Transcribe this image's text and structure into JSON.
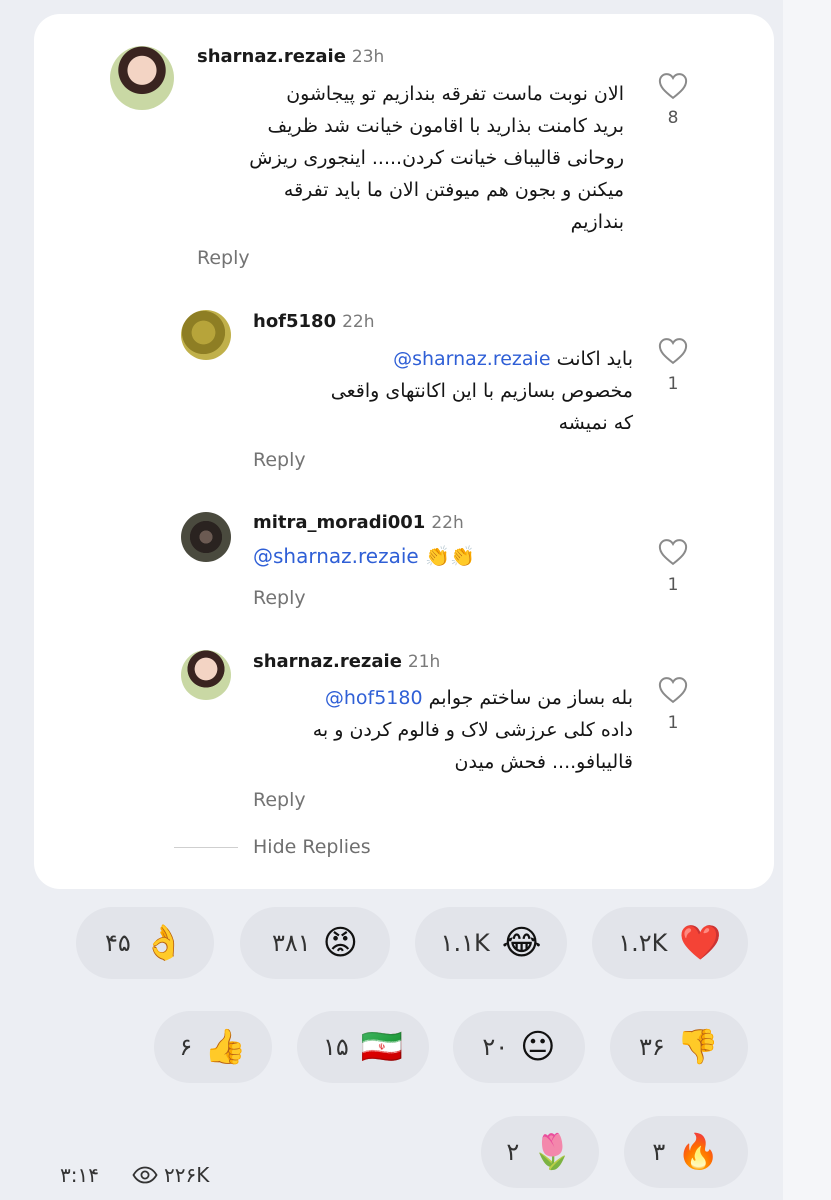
{
  "comments": [
    {
      "username": "sharnaz.rezaie",
      "time": "23h",
      "text_lines": [
        "الان نوبت ماست تفرقه بندازیم تو پیجاشون",
        "برید کامنت بذارید با اقامون خیانت شد ظریف",
        "روحانی قالیباف خیانت کردن..... اینجوری ریزش",
        "میکنن و بجون هم میوفتن الان ما باید تفرقه",
        "بندازیم"
      ],
      "likes": "8",
      "reply_label": "Reply"
    },
    {
      "username": "hof5180",
      "time": "22h",
      "mention": "@sharnaz.rezaie",
      "text_first": "باید اکانت",
      "text_lines": [
        "مخصوص بسازیم با این اکانتهای واقعی",
        "که نمیشه"
      ],
      "likes": "1",
      "reply_label": "Reply"
    },
    {
      "username": "mitra_moradi001",
      "time": "22h",
      "mention": "@sharnaz.rezaie",
      "emoji": "👏👏",
      "likes": "1",
      "reply_label": "Reply"
    },
    {
      "username": "sharnaz.rezaie",
      "time": "21h",
      "mention": "@hof5180",
      "text_first": "بله بساز من ساختم جوابم",
      "text_lines": [
        "داده کلی عرزشی لاک و فالوم کردن و به",
        "قالیبافو.... فحش میدن"
      ],
      "likes": "1",
      "reply_label": "Reply"
    }
  ],
  "hide_replies": "Hide Replies",
  "reactions": [
    {
      "emoji": "❤️",
      "count": "۱.۲K",
      "icon": "heart-emoji"
    },
    {
      "emoji": "😂",
      "count": "۱.۱K",
      "icon": "laughing-emoji"
    },
    {
      "emoji": "😡",
      "count": "۳۸۱",
      "icon": "angry-emoji"
    },
    {
      "emoji": "👌",
      "count": "۴۵",
      "icon": "ok-hand-emoji"
    },
    {
      "emoji": "👎",
      "count": "۳۶",
      "icon": "thumbs-down-emoji"
    },
    {
      "emoji": "😐",
      "count": "۲۰",
      "icon": "neutral-face-emoji"
    },
    {
      "emoji": "🇮🇷",
      "count": "۱۵",
      "icon": "iran-flag-emoji"
    },
    {
      "emoji": "👍",
      "count": "۶",
      "icon": "thumbs-up-emoji"
    },
    {
      "emoji": "🔥",
      "count": "۳",
      "icon": "fire-emoji"
    },
    {
      "emoji": "🌷",
      "count": "۲",
      "icon": "tulip-emoji"
    }
  ],
  "footer": {
    "time": "۳:۱۴",
    "views": "۲۲۶K",
    "views_icon": "eye-icon"
  }
}
